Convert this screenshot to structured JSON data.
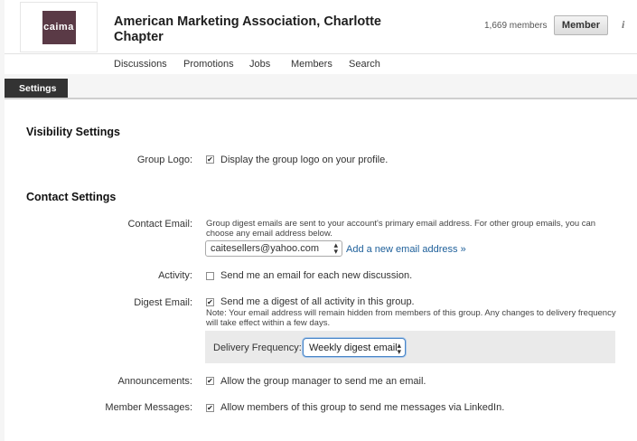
{
  "header": {
    "logo_text": "caima",
    "group_title": "American Marketing Association, Charlotte Chapter",
    "member_count": "1,669 members",
    "member_button": "Member",
    "info_icon": "i"
  },
  "nav": [
    "Discussions",
    "Promotions",
    "Jobs",
    "Members",
    "Search"
  ],
  "tab": "Settings",
  "visibility": {
    "title": "Visibility Settings",
    "group_logo_label": "Group Logo:",
    "group_logo_text": "Display the group logo on your profile.",
    "group_logo_checked": true
  },
  "contact": {
    "title": "Contact Settings",
    "email_label": "Contact Email:",
    "email_note": "Group digest emails are sent to your account's primary email address. For other group emails, you can choose any email address below.",
    "email_value": "caitesellers@yahoo.com",
    "add_email": "Add a new email address »",
    "activity_label": "Activity:",
    "activity_text": "Send me an email for each new discussion.",
    "activity_checked": false,
    "digest_label": "Digest Email:",
    "digest_text": "Send me a digest of all activity in this group.",
    "digest_checked": true,
    "digest_note": "Note: Your email address will remain hidden from members of this group. Any changes to delivery frequency will take effect within a few days.",
    "frequency_label": "Delivery Frequency:",
    "frequency_value": "Weekly digest email",
    "announcements_label": "Announcements:",
    "announcements_text": "Allow the group manager to send me an email.",
    "announcements_checked": true,
    "messages_label": "Member Messages:",
    "messages_text": "Allow members of this group to send me messages via LinkedIn.",
    "messages_checked": true
  },
  "icons": {
    "checkmark": "✔",
    "select_arrows": "▴▾"
  }
}
